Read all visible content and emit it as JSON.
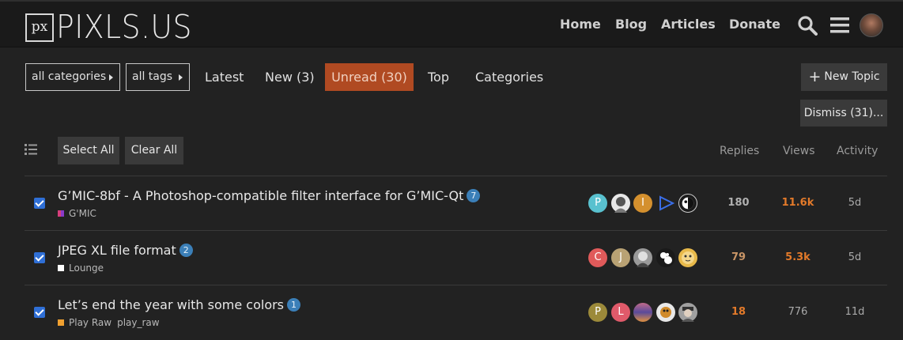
{
  "header": {
    "logo_box": "px",
    "logo_text": "PIXLS.US",
    "nav": [
      "Home",
      "Blog",
      "Articles",
      "Donate"
    ],
    "icons": [
      "search-icon",
      "menu-icon",
      "user-avatar"
    ]
  },
  "filters": {
    "categories": "all categories",
    "tags": "all tags"
  },
  "tabs": {
    "latest": "Latest",
    "new": "New (3)",
    "unread": "Unread (30)",
    "top": "Top",
    "categories": "Categories"
  },
  "actions": {
    "new_topic": "New Topic",
    "dismiss": "Dismiss (31)...",
    "select_all": "Select All",
    "clear_all": "Clear All"
  },
  "columns": {
    "replies": "Replies",
    "views": "Views",
    "activity": "Activity"
  },
  "colors": {
    "accent": "#b04a22",
    "badge": "#3b7fb8",
    "hot": "#e37a2a",
    "warm": "#c99566",
    "checkbox": "#2f6fd6"
  },
  "topics": [
    {
      "title": "G’MIC-8bf - A Photoshop-compatible filter interface for G’MIC-Qt",
      "badge": "7",
      "category": "G'MIC",
      "category_color": "#d63e7c",
      "tag": "",
      "replies": "180",
      "views": "11.6k",
      "activity": "5d",
      "avatars": [
        {
          "letter": "P",
          "color": "#59c1cf"
        },
        {
          "letter": "",
          "color": "#e8e8e8",
          "kind": "photo"
        },
        {
          "letter": "I",
          "color": "#d4902e"
        },
        {
          "letter": "",
          "color": "#222222",
          "kind": "triangle"
        },
        {
          "letter": "",
          "color": "#1a1a1a",
          "kind": "photo"
        }
      ]
    },
    {
      "title": "JPEG XL file format",
      "badge": "2",
      "category": "Lounge",
      "category_color": "#ffffff",
      "tag": "",
      "replies": "79",
      "views": "5.3k",
      "activity": "5d",
      "avatars": [
        {
          "letter": "C",
          "color": "#e05a5a"
        },
        {
          "letter": "J",
          "color": "#b9a274"
        },
        {
          "letter": "",
          "color": "#9a9a9a",
          "kind": "photo"
        },
        {
          "letter": "",
          "color": "#1a1a1a",
          "kind": "photo"
        },
        {
          "letter": "",
          "color": "#e8b94a",
          "kind": "photo"
        }
      ]
    },
    {
      "title": "Let’s end the year with some colors",
      "badge": "1",
      "category": "Play Raw",
      "category_color": "#f0a030",
      "tag": "play_raw",
      "replies": "18",
      "views": "776",
      "activity": "11d",
      "avatars": [
        {
          "letter": "P",
          "color": "#9c8a3a"
        },
        {
          "letter": "L",
          "color": "#e05a6a"
        },
        {
          "letter": "",
          "color": "#8a4a7a",
          "kind": "photo"
        },
        {
          "letter": "",
          "color": "#e8e8e8",
          "kind": "photo"
        },
        {
          "letter": "",
          "color": "#a0a0a0",
          "kind": "photo"
        }
      ]
    }
  ]
}
